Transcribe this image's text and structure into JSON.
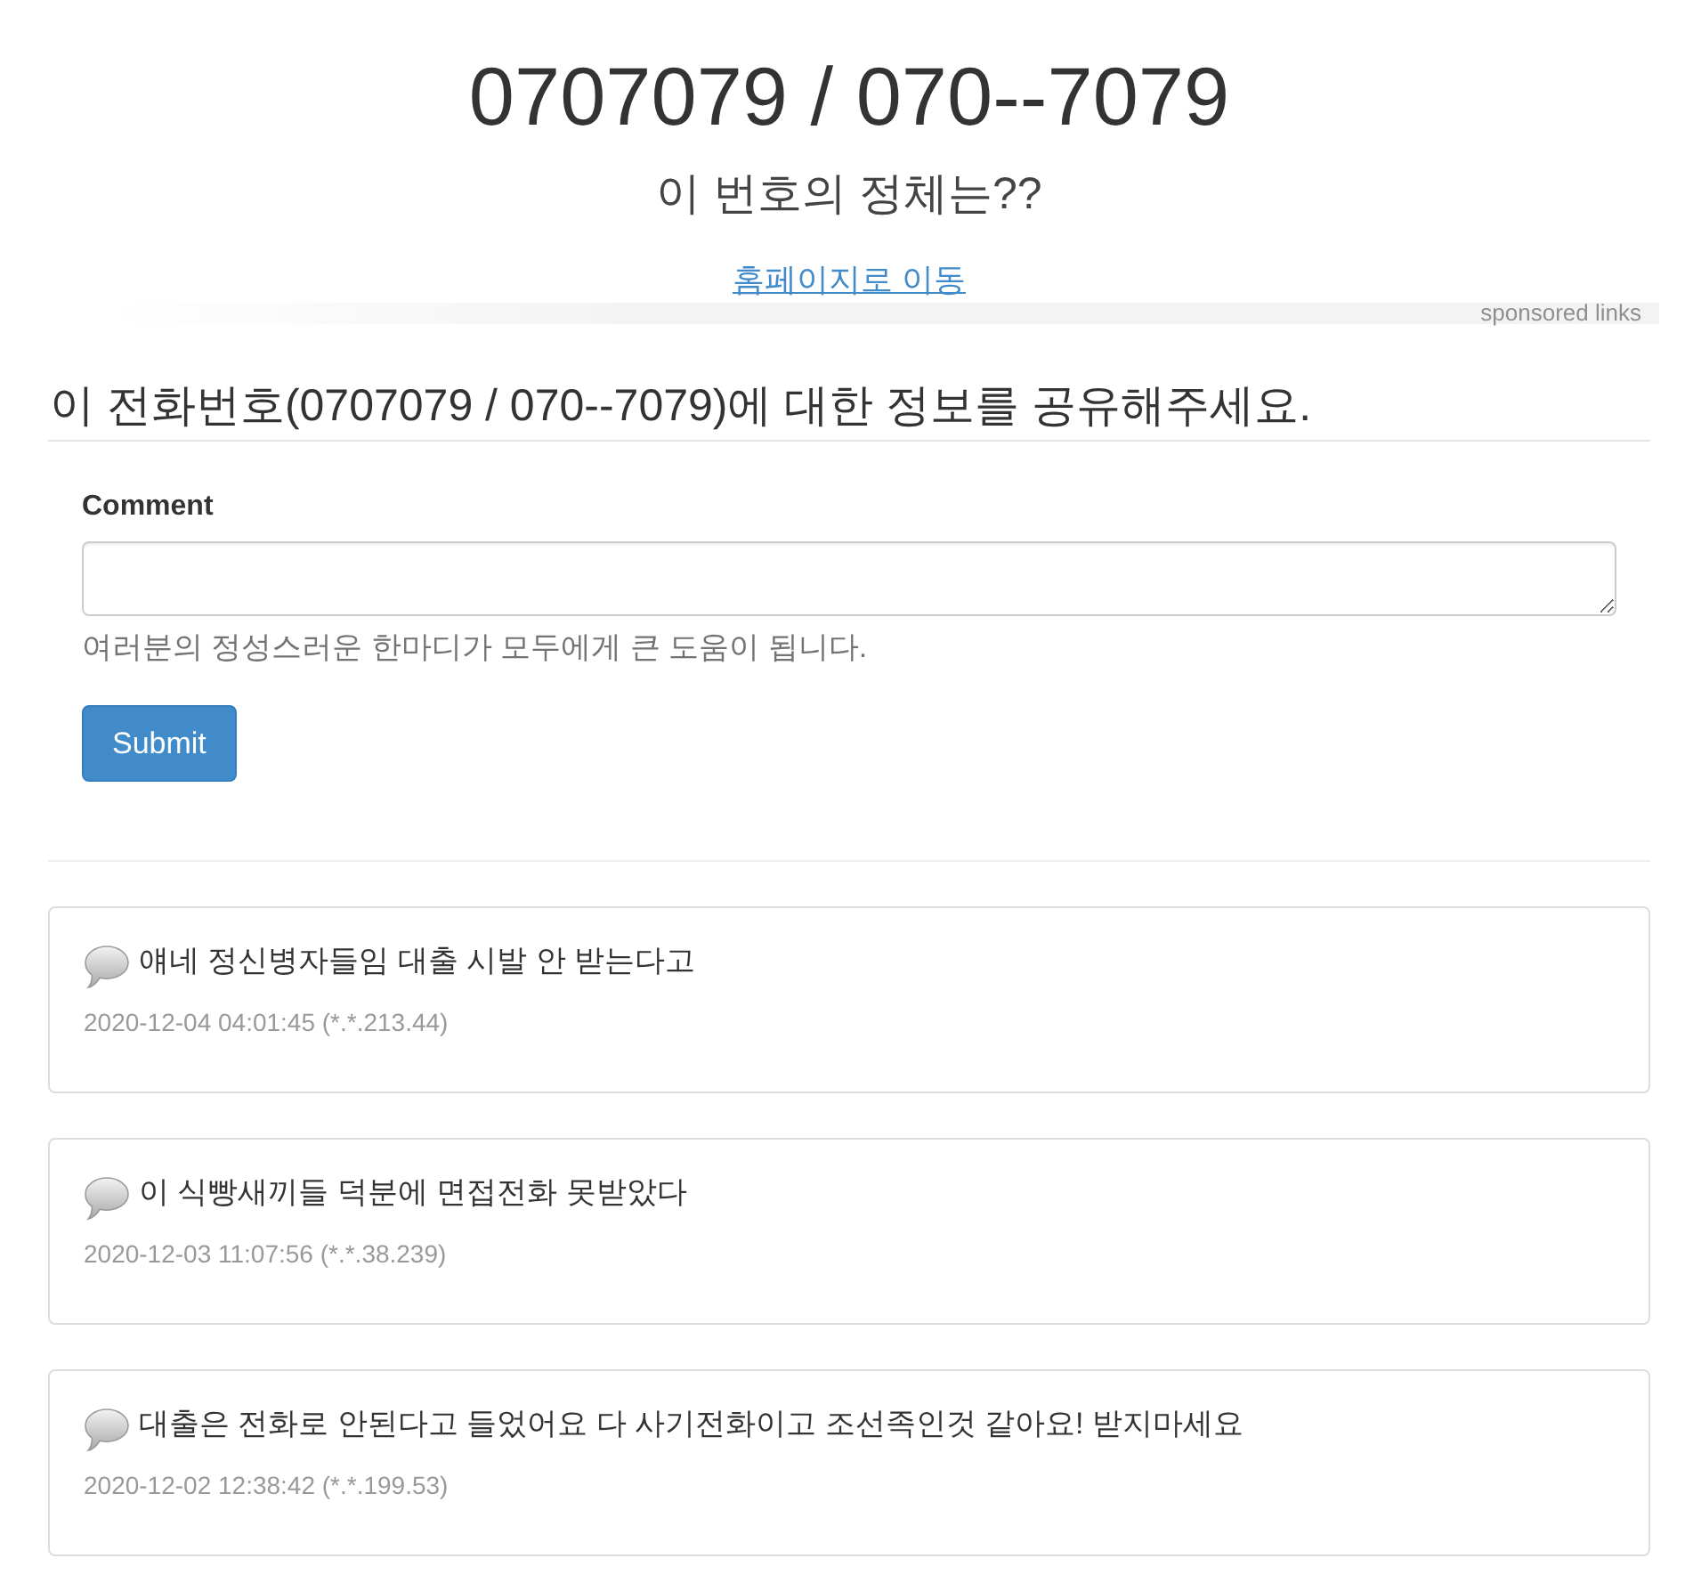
{
  "header": {
    "title": "0707079 / 070--7079",
    "subtitle": "이 번호의 정체는??",
    "home_link": "홈페이지로 이동"
  },
  "ad_bar": {
    "label": "sponsored links"
  },
  "form": {
    "heading": "이 전화번호(0707079 / 070--7079)에 대한 정보를 공유해주세요.",
    "field_label": "Comment",
    "help_text": "여러분의 정성스러운 한마디가 모두에게 큰 도움이 됩니다.",
    "submit": "Submit"
  },
  "comments": [
    {
      "text": "얘네 정신병자들임 대출 시발 안 받는다고",
      "meta": "2020-12-04 04:01:45 (*.*.213.44)"
    },
    {
      "text": "이 식빵새끼들 덕분에 면접전화 못받았다",
      "meta": "2020-12-03 11:07:56 (*.*.38.239)"
    },
    {
      "text": "대출은 전화로 안된다고 들었어요 다 사기전화이고 조선족인것 같아요! 받지마세요",
      "meta": "2020-12-02 12:38:42 (*.*.199.53)"
    }
  ]
}
